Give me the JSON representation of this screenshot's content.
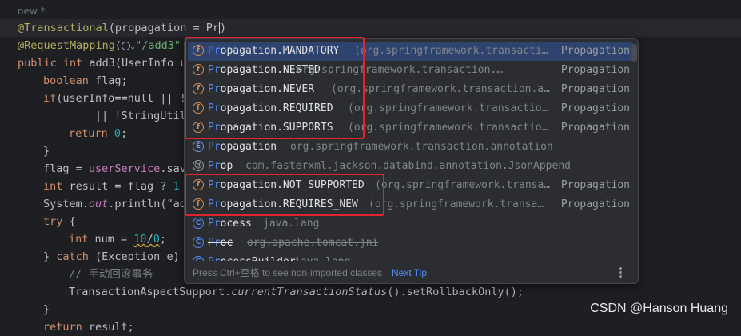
{
  "editor": {
    "new_label": "new *",
    "lines": {
      "l1_ann": "@Transactional",
      "l1_args": "(propagation = Pr",
      "l2_ann": "@RequestMapping",
      "l2_open": "(",
      "l2_str": "\"/add3\"",
      "l3_kw": "public int",
      "l3_rest": " add3(UserInfo u",
      "l4_kw": "boolean",
      "l4_rest": " flag;",
      "l5_kw": "if",
      "l5_rest": "(userInfo==null || !",
      "l6_rest": "|| !StringUtil",
      "l7_kw": "return",
      "l7_num": "0",
      "l7_end": ";",
      "l8": "}",
      "l9_pre": "flag = ",
      "l9_fld": "userService",
      "l9_post": ".sav",
      "l10_kw": "int",
      "l10_mid": " result = flag ? ",
      "l10_num": "1",
      "l11_pre": "System.",
      "l11_fld": "out",
      "l11_post": ".println(\"ad",
      "l12_kw": "try",
      "l12_post": " {",
      "l13_kw": "int",
      "l13_mid": " num = ",
      "l13_num1": "10",
      "l13_op": "/",
      "l13_num2": "0",
      "l13_end": ";",
      "l14_pre": "} ",
      "l14_kw": "catch",
      "l14_post": " (Exception e)",
      "l15": "// 手动回滚事务",
      "l16_pre": "TransactionAspectSupport.",
      "l16_call": "currentTransactionStatus",
      "l16_post": "().setRollbackOnly();",
      "l17": "}",
      "l18_kw": "return",
      "l18_post": " result;"
    }
  },
  "completion_popup": {
    "items": [
      {
        "icon": "field-icon",
        "match": "Pr",
        "rest": "opagation.MANDATORY",
        "package": "(org.springframework.transacti…",
        "type": "Propagation",
        "selected": true
      },
      {
        "icon": "field-icon",
        "match": "Pr",
        "rest": "opagation.NESTED",
        "package": "(org.springframework.transaction.…",
        "type": "Propagation"
      },
      {
        "icon": "field-icon",
        "match": "Pr",
        "rest": "opagation.NEVER",
        "package": "(org.springframework.transaction.a…",
        "type": "Propagation"
      },
      {
        "icon": "field-icon",
        "match": "Pr",
        "rest": "opagation.REQUIRED",
        "package": "(org.springframework.transactio…",
        "type": "Propagation"
      },
      {
        "icon": "field-icon",
        "match": "Pr",
        "rest": "opagation.SUPPORTS",
        "package": "(org.springframework.transactio…",
        "type": "Propagation"
      },
      {
        "icon": "enum-icon",
        "match": "Pr",
        "rest": "opagation",
        "package": "org.springframework.transaction.annotation",
        "type": ""
      },
      {
        "icon": "annotation-icon",
        "match": "Pr",
        "rest": "op",
        "package": "com.fasterxml.jackson.databind.annotation.JsonAppend",
        "type": ""
      },
      {
        "icon": "field-icon",
        "match": "Pr",
        "rest": "opagation.NOT_SUPPORTED",
        "package": "(org.springframework.transa…",
        "type": "Propagation"
      },
      {
        "icon": "field-icon",
        "match": "Pr",
        "rest": "opagation.REQUIRES_NEW",
        "package": "(org.springframework.transa…",
        "type": "Propagation"
      },
      {
        "icon": "class-icon",
        "match": "Pr",
        "rest": "ocess",
        "package": "java.lang",
        "type": ""
      },
      {
        "icon": "class-icon",
        "match": "Pr",
        "rest": "oc",
        "package": "org.apache.tomcat.jni",
        "type": "",
        "deprecated": true
      },
      {
        "icon": "class-icon",
        "match": "Pr",
        "rest": "ocessBuilder",
        "package": "java.lang",
        "type": ""
      }
    ],
    "icon_letters": {
      "field-icon": "f",
      "enum-icon": "E",
      "annotation-icon": "@",
      "class-icon": "C"
    },
    "footer": {
      "hint": "Press Ctrl+空格 to see non-imported classes",
      "next_tip": "Next Tip",
      "menu_glyph": "⋮"
    }
  },
  "watermark": "CSDN @Hanson Huang",
  "colors": {
    "highlight_box": "#e0262c",
    "selection": "#2e436e",
    "match": "#548af7"
  }
}
